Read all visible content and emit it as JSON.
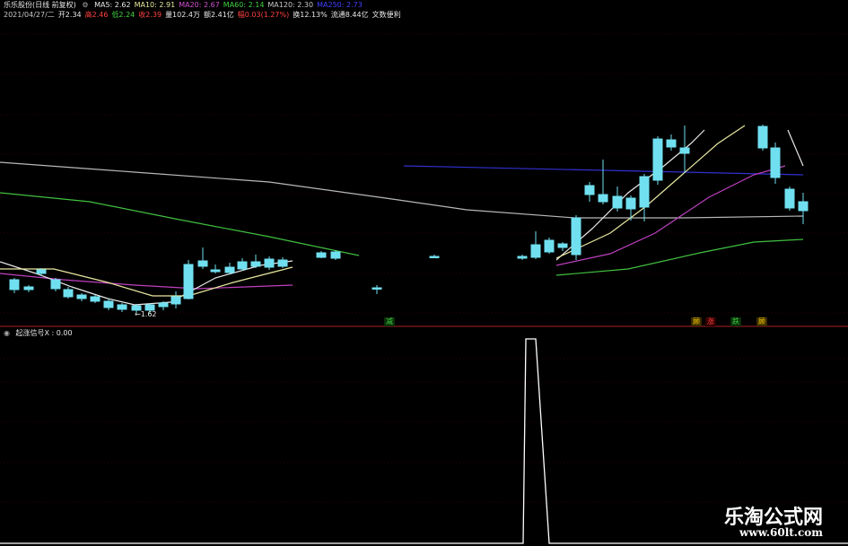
{
  "header": {
    "stock_name": "乐乐股份(日线 前复权)",
    "ma_items": [
      {
        "text": "MA5: 2.62",
        "color": "#e8e8e8"
      },
      {
        "text": "MA10: 2.91",
        "color": "#e8e8a0"
      },
      {
        "text": "MA20: 2.67",
        "color": "#d050d0"
      },
      {
        "text": "MA60: 2.14",
        "color": "#40d040"
      },
      {
        "text": "MA120: 2.30",
        "color": "#c8c8c8"
      },
      {
        "text": "MA250: 2.73",
        "color": "#4040ff"
      }
    ],
    "quote_items": [
      {
        "text": "2021/04/27/二",
        "color": "#c8c8c8"
      },
      {
        "text": "开2.34",
        "color": "#e8e8e8"
      },
      {
        "text": "高2.46",
        "color": "#ff4040"
      },
      {
        "text": "低2.24",
        "color": "#40d040"
      },
      {
        "text": "收2.39",
        "color": "#ff4040"
      },
      {
        "text": "量102.4万",
        "color": "#e8e8e8"
      },
      {
        "text": "额2.41亿",
        "color": "#e8e8e8"
      },
      {
        "text": "幅0.03(1.27%)",
        "color": "#ff4040"
      },
      {
        "text": "换12.13%",
        "color": "#e8e8e8"
      },
      {
        "text": "流通8.44亿",
        "color": "#e8e8e8"
      },
      {
        "text": "文数便利",
        "color": "#e8e8e8"
      }
    ]
  },
  "price_annotation": "←1.62",
  "signals": [
    {
      "text": "减",
      "color": "#40d040",
      "bg": "#0a300a"
    },
    {
      "text": "顾",
      "color": "#ffd700",
      "bg": "#3a2a00"
    },
    {
      "text": "涨",
      "color": "#ff4040",
      "bg": "#300000"
    },
    {
      "text": "跌",
      "color": "#40d040",
      "bg": "#0a300a"
    },
    {
      "text": "顾",
      "color": "#ffd700",
      "bg": "#3a2a00"
    }
  ],
  "indicator": {
    "label": "起涨信号X : 0.00",
    "line_values": [
      0,
      0,
      0,
      1,
      1,
      0,
      0
    ],
    "line_color": "#ffffff"
  },
  "watermark": {
    "title": "乐淘公式网",
    "url": "www.60lt.com"
  },
  "icons": {
    "settings": "gear-icon",
    "indicator": "indicator-icon"
  },
  "colors": {
    "bull": "#c03030",
    "bear": "#70e0f0",
    "ma5": "#e8e8e8",
    "ma10": "#e8e8a0",
    "ma20": "#c040c0",
    "ma60": "#40c040",
    "ma120": "#b8b8b8",
    "ma250": "#3030d0",
    "grid": "#5a0000"
  }
}
